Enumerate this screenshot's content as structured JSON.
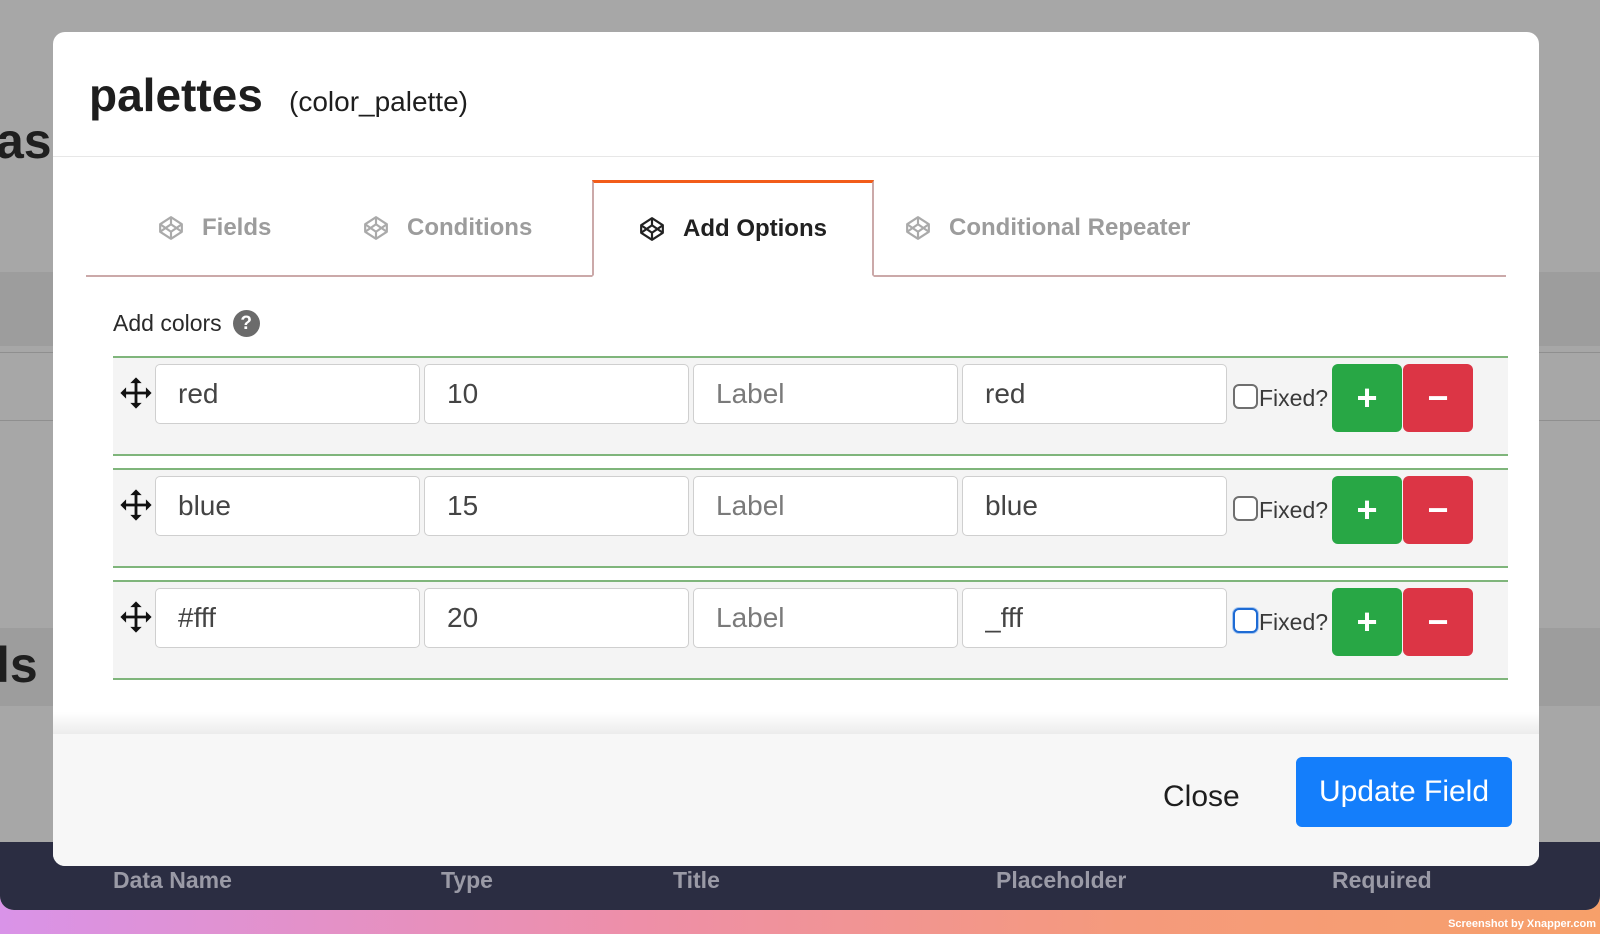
{
  "background": {
    "heading_partial_1": "asi",
    "heading_partial_2": "ls",
    "table_headers": [
      "Data Name",
      "Type",
      "Title",
      "Placeholder",
      "Required"
    ]
  },
  "modal": {
    "title": "palettes",
    "subtitle": "(color_palette)",
    "tabs": [
      {
        "label": "Fields",
        "icon": "codepen-icon",
        "active": false
      },
      {
        "label": "Conditions",
        "icon": "codepen-icon",
        "active": false
      },
      {
        "label": "Add Options",
        "icon": "codepen-icon",
        "active": true
      },
      {
        "label": "Conditional Repeater",
        "icon": "codepen-icon",
        "active": false
      }
    ],
    "add_colors_label": "Add colors",
    "help_symbol": "?",
    "rows": [
      {
        "name": "red",
        "value": "10",
        "label_placeholder": "Label",
        "slug": "red",
        "fixed_label": "Fixed?",
        "fixed_checked": false,
        "focused": false
      },
      {
        "name": "blue",
        "value": "15",
        "label_placeholder": "Label",
        "slug": "blue",
        "fixed_label": "Fixed?",
        "fixed_checked": false,
        "focused": false
      },
      {
        "name": "#fff",
        "value": "20",
        "label_placeholder": "Label",
        "slug": "_fff",
        "fixed_label": "Fixed?",
        "fixed_checked": false,
        "focused": true
      }
    ],
    "add_symbol": "+",
    "remove_symbol": "−",
    "close_label": "Close",
    "update_label": "Update Field"
  },
  "credit": "Screenshot by Xnapper.com",
  "colors": {
    "add": "#28a745",
    "remove": "#dc3545",
    "primary": "#147efb",
    "active_tab": "#f25c19"
  }
}
